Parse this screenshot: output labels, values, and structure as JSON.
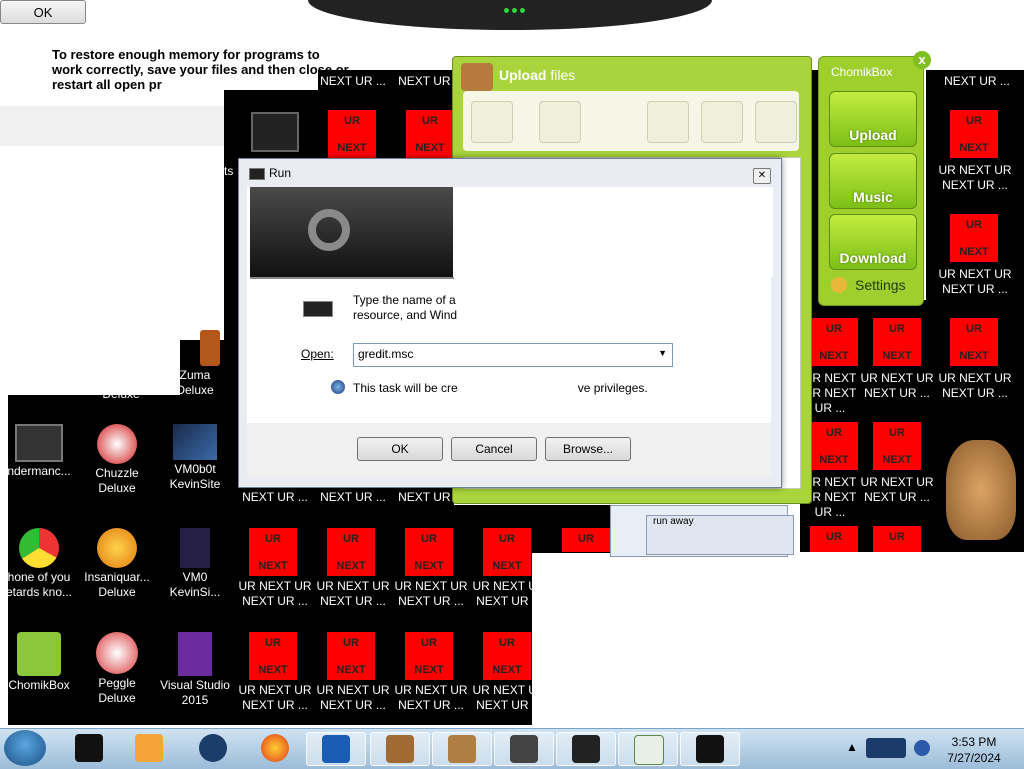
{
  "top": {
    "ok_label": "OK",
    "memory_message": "To restore enough memory for programs to work correctly, save your files and then close or restart all open pr"
  },
  "desktop": {
    "left_icons": [
      {
        "label": "Zuma Deluxe"
      },
      {
        "label": "ney Deluxe"
      },
      {
        "label": "ndermanc..."
      },
      {
        "label": "Chuzzle Deluxe"
      },
      {
        "label": "VM0b0t KevinSite"
      },
      {
        "label": "hone of you etards kno..."
      },
      {
        "label": "Insaniquar... Deluxe"
      },
      {
        "label": "VM0 KevinSi..."
      },
      {
        "label": "ChomikBox"
      },
      {
        "label": "Peggle Deluxe"
      },
      {
        "label": "Visual Studio 2015"
      }
    ],
    "ur_tile_top": "UR",
    "ur_tile_bottom": "NEXT",
    "ur_label_short": "NEXT UR ...",
    "ur_label_long": "UR NEXT UR NEXT UR ...",
    "misc_text": "ts"
  },
  "upload_window": {
    "title_bold": "Upload",
    "title_rest": " files"
  },
  "chomikbox": {
    "title": "ChomikBox",
    "close": "x",
    "upload": "Upload",
    "music": "Music",
    "download": "Download",
    "settings": "Settings"
  },
  "run_dialog": {
    "title": "Run",
    "close": "✕",
    "prompt_line1": "Type the name of a",
    "prompt_line2": "resource, and Wind",
    "open_label": "Open:",
    "open_value": "gredit.msc",
    "note_left": "This task will be cre",
    "note_right": "ve privileges.",
    "ok": "OK",
    "cancel": "Cancel",
    "browse": "Browse..."
  },
  "stack_windows": {
    "label": "run away"
  },
  "taskbar": {
    "time": "3:53 PM",
    "date": "7/27/2024"
  },
  "colors": {
    "ur_red": "#ff0000",
    "chomik_green": "#9fcf2d",
    "taskbar_blue": "#b7d1e8"
  }
}
